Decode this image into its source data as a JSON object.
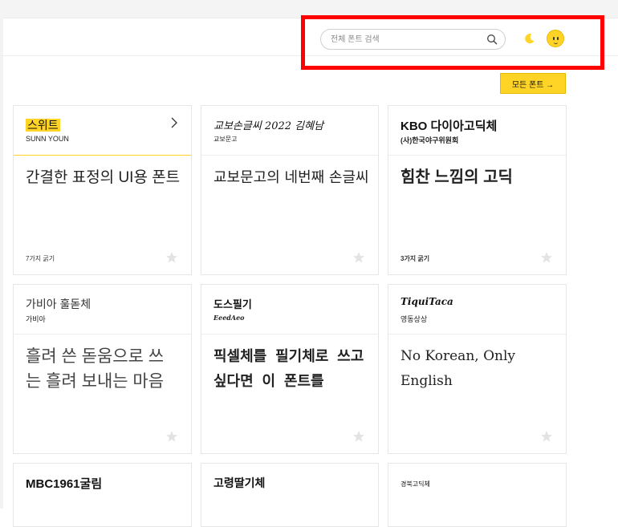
{
  "search": {
    "placeholder": "전체 폰트 검색",
    "value": ""
  },
  "all_fonts_button": "모든 폰트 →",
  "cards": [
    {
      "title": "스위트",
      "author": "SUNN YOUN",
      "sample": "간결한 표정의 UI용 폰트",
      "weights": "7가지 굵기"
    },
    {
      "title": "교보손글씨 2022 김혜남",
      "author": "교보문고",
      "sample": "교보문고의 네번째 손글씨",
      "weights": ""
    },
    {
      "title": "KBO 다이아고딕체",
      "author": "(사)한국야구위원회",
      "sample": "힘찬 느낌의 고딕",
      "weights": "3가지 굵기"
    },
    {
      "title": "가비아 훌돋체",
      "author": "가비아",
      "sample": "흘려 쓴 돋움으로 쓰는 흘려 보내는 마음",
      "weights": ""
    },
    {
      "title": "도스필기",
      "author": "EeedAeo",
      "sample": "픽셀체를 필기체로 쓰고싶다면 이 폰트를",
      "weights": ""
    },
    {
      "title": "TiquiTaca",
      "author": "영동상상",
      "sample": "No Korean, Only English",
      "weights": ""
    },
    {
      "title": "MBC1961굴림",
      "author": "",
      "sample": "",
      "weights": ""
    },
    {
      "title": "고령딸기체",
      "author": "",
      "sample": "",
      "weights": ""
    },
    {
      "title": "경북고딕체",
      "author": "",
      "sample": "",
      "weights": ""
    }
  ],
  "colors": {
    "accent": "#ffd426",
    "highlight_border": "#ff0000"
  },
  "icons": {
    "search": "search-icon",
    "theme": "moon-icon",
    "profile": "avatar",
    "card_open": "chevron-right-icon",
    "favorite": "star-icon"
  }
}
